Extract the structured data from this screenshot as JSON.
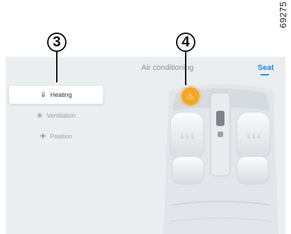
{
  "reference_code": "69275",
  "callouts": [
    {
      "number": "3"
    },
    {
      "number": "4"
    }
  ],
  "tabs": [
    {
      "label": "Air conditioning",
      "active": false
    },
    {
      "label": "Seat",
      "active": true
    }
  ],
  "menu": {
    "items": [
      {
        "label": "Heating",
        "icon": "heat-waves-icon",
        "active": true
      },
      {
        "label": "Ventilation",
        "icon": "fan-icon",
        "active": false
      },
      {
        "label": "Position",
        "icon": "move-arrows-icon",
        "active": false
      }
    ]
  },
  "seat_heating_button": {
    "icon": "seat-heat-icon",
    "active": true
  },
  "colors": {
    "accent": "#1c8ee0",
    "heating_active": "#f5a623",
    "panel_bg": "#ebeef1"
  }
}
